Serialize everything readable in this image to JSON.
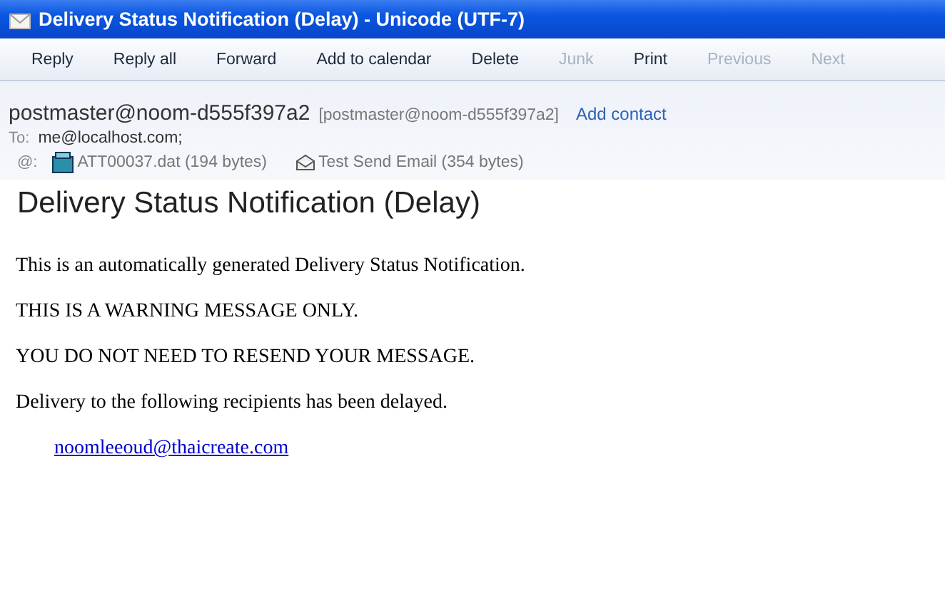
{
  "window": {
    "title": "Delivery Status Notification (Delay) - Unicode (UTF-7)"
  },
  "toolbar": [
    {
      "label": "Reply",
      "disabled": false
    },
    {
      "label": "Reply all",
      "disabled": false
    },
    {
      "label": "Forward",
      "disabled": false
    },
    {
      "label": "Add to calendar",
      "disabled": false
    },
    {
      "label": "Delete",
      "disabled": false
    },
    {
      "label": "Junk",
      "disabled": true
    },
    {
      "label": "Print",
      "disabled": false
    },
    {
      "label": "Previous",
      "disabled": true
    },
    {
      "label": "Next",
      "disabled": true
    }
  ],
  "header": {
    "sender": "postmaster@noom-d555f397a2",
    "sender_address": "[postmaster@noom-d555f397a2]",
    "add_contact": "Add contact",
    "to_label": "To:",
    "to": "me@localhost.com;",
    "attachments_label": "@:",
    "attachments": [
      {
        "kind": "file",
        "name": "ATT00037.dat (194 bytes)"
      },
      {
        "kind": "email",
        "name": "Test Send Email (354 bytes)"
      }
    ]
  },
  "subject": "Delivery Status Notification (Delay)",
  "body": [
    {
      "kind": "text",
      "text": "This is an automatically generated Delivery Status Notification."
    },
    {
      "kind": "text",
      "text": "THIS IS A WARNING MESSAGE ONLY."
    },
    {
      "kind": "text",
      "text": "YOU DO NOT NEED TO RESEND YOUR MESSAGE."
    },
    {
      "kind": "text",
      "text": "Delivery to the following recipients has been delayed."
    },
    {
      "kind": "link",
      "text": "noomleeoud@thaicreate.com"
    }
  ]
}
